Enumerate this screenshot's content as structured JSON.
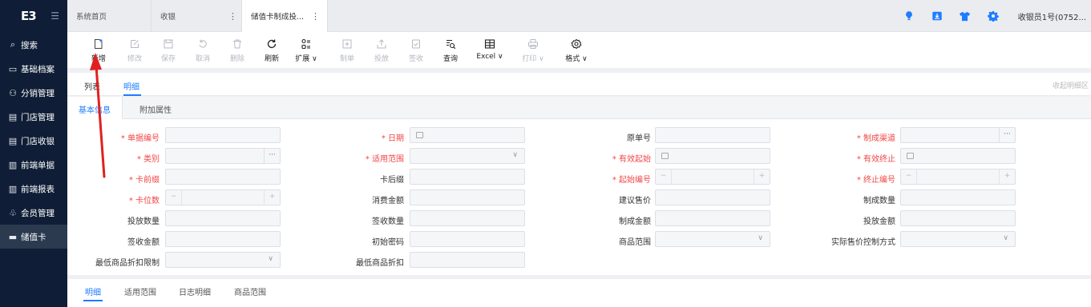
{
  "sidebar": {
    "logo": "E3",
    "collapse_icon": "menu-fold-icon",
    "items": [
      {
        "label": "搜索",
        "icon": "search-icon",
        "glyph": "⌕"
      },
      {
        "label": "基础档案",
        "icon": "archive-icon",
        "glyph": "▭"
      },
      {
        "label": "分销管理",
        "icon": "distribution-icon",
        "glyph": "⚇"
      },
      {
        "label": "门店管理",
        "icon": "store-icon",
        "glyph": "▤"
      },
      {
        "label": "门店收银",
        "icon": "cashier-icon",
        "glyph": "▤"
      },
      {
        "label": "前端单据",
        "icon": "document-icon",
        "glyph": "▥"
      },
      {
        "label": "前端报表",
        "icon": "report-icon",
        "glyph": "▥"
      },
      {
        "label": "会员管理",
        "icon": "member-icon",
        "glyph": "♧"
      },
      {
        "label": "储值卡",
        "icon": "card-icon",
        "glyph": "▬"
      }
    ]
  },
  "tabs": [
    {
      "label": "系统首页"
    },
    {
      "label": "收银",
      "more": "⋮"
    },
    {
      "label": "储值卡制成投...",
      "more": "⋮"
    }
  ],
  "header": {
    "user": "收银员1号(0752...",
    "colors": {
      "icon_blue": "#1e7cff"
    }
  },
  "toolbar": {
    "buttons": [
      {
        "label": "新增",
        "state": "enabled"
      },
      {
        "label": "修改",
        "state": "disabled"
      },
      {
        "label": "保存",
        "state": "disabled"
      },
      {
        "label": "取消",
        "state": "disabled"
      },
      {
        "label": "删除",
        "state": "disabled"
      },
      {
        "label": "刷新",
        "state": "enabled"
      },
      {
        "label": "扩展 ∨",
        "state": "enabled"
      },
      {
        "label": "制单",
        "state": "disabled"
      },
      {
        "label": "投放",
        "state": "disabled"
      },
      {
        "label": "签收",
        "state": "disabled"
      },
      {
        "label": "查询",
        "state": "enabled"
      },
      {
        "label": "Excel ∨",
        "state": "enabled"
      },
      {
        "label": "打印 ∨",
        "state": "disabled"
      },
      {
        "label": "格式 ∨",
        "state": "enabled"
      }
    ]
  },
  "view_tabs": {
    "list": "列表",
    "detail": "明细",
    "collapse": "收起明细区"
  },
  "sub_tabs": {
    "basic": "基本信息",
    "extra": "附加属性"
  },
  "form": {
    "fields": {
      "doc_no": {
        "label": "* 单据编号",
        "value": ""
      },
      "date": {
        "label": "* 日期",
        "value": ""
      },
      "orig_no": {
        "label": "原单号",
        "value": ""
      },
      "channel": {
        "label": "* 制成渠道",
        "value": ""
      },
      "category": {
        "label": "* 类别",
        "value": ""
      },
      "scope": {
        "label": "* 适用范围",
        "value": ""
      },
      "valid_start": {
        "label": "* 有效起始",
        "value": ""
      },
      "valid_end": {
        "label": "* 有效终止",
        "value": ""
      },
      "card_prefix": {
        "label": "* 卡前缀",
        "value": ""
      },
      "card_suffix": {
        "label": "卡后缀",
        "value": ""
      },
      "start_no": {
        "label": "* 起始编号",
        "value": ""
      },
      "end_no": {
        "label": "* 终止编号",
        "value": ""
      },
      "card_digits": {
        "label": "* 卡位数",
        "value": ""
      },
      "consume_amount": {
        "label": "消费金额",
        "value": ""
      },
      "suggest_price": {
        "label": "建议售价",
        "value": ""
      },
      "make_qty": {
        "label": "制成数量",
        "value": ""
      },
      "issue_qty": {
        "label": "投放数量",
        "value": ""
      },
      "receive_qty": {
        "label": "签收数量",
        "value": ""
      },
      "make_amount": {
        "label": "制成金额",
        "value": ""
      },
      "issue_amount": {
        "label": "投放金额",
        "value": ""
      },
      "receive_amount": {
        "label": "签收金额",
        "value": ""
      },
      "init_pwd": {
        "label": "初始密码",
        "value": ""
      },
      "goods_scope": {
        "label": "商品范围",
        "value": ""
      },
      "price_ctrl": {
        "label": "实际售价控制方式",
        "value": ""
      },
      "min_discount_limit": {
        "label": "最低商品折扣限制",
        "value": ""
      },
      "min_discount": {
        "label": "最低商品折扣",
        "value": ""
      }
    }
  },
  "bottom_tabs": [
    "明细",
    "适用范围",
    "日志明细",
    "商品范围"
  ]
}
